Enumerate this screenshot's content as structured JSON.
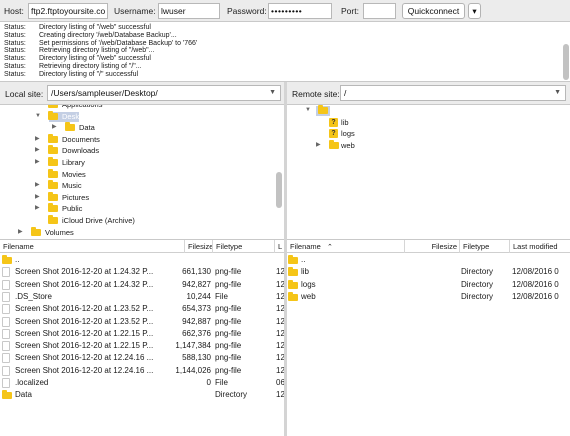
{
  "quickconnect": {
    "host_label": "Host:",
    "host_value": "ftp2.ftptoyoursite.co",
    "username_label": "Username:",
    "username_value": "lwuser",
    "password_label": "Password:",
    "password_value": "•••••••••",
    "port_label": "Port:",
    "port_value": "",
    "connect_label": "Quickconnect",
    "dropdown_glyph": "▾"
  },
  "log": [
    {
      "key": "Status:",
      "msg": "Directory listing of \"/web\" successful"
    },
    {
      "key": "Status:",
      "msg": "Creating directory '/web/Database Backup'..."
    },
    {
      "key": "Status:",
      "msg": "Set permissions of '/web/Database Backup' to '766'"
    },
    {
      "key": "Status:",
      "msg": "Retrieving directory listing of \"/web\"..."
    },
    {
      "key": "Status:",
      "msg": "Directory listing of \"/web\" successful"
    },
    {
      "key": "Status:",
      "msg": "Retrieving directory listing of \"/\"..."
    },
    {
      "key": "Status:",
      "msg": "Directory listing of \"/\" successful"
    }
  ],
  "local_site": {
    "label": "Local site:",
    "path": "/Users/sampleuser/Desktop/"
  },
  "remote_site": {
    "label": "Remote site:",
    "path": "/"
  },
  "local_tree": [
    {
      "name": "Applications",
      "indent": 1,
      "twisty": ""
    },
    {
      "name": "Desktop",
      "indent": 1,
      "twisty": "▼",
      "selected": true
    },
    {
      "name": "Data",
      "indent": 2,
      "twisty": "▶"
    },
    {
      "name": "Documents",
      "indent": 1,
      "twisty": "▶"
    },
    {
      "name": "Downloads",
      "indent": 1,
      "twisty": "▶"
    },
    {
      "name": "Library",
      "indent": 1,
      "twisty": "▶"
    },
    {
      "name": "Movies",
      "indent": 1,
      "twisty": ""
    },
    {
      "name": "Music",
      "indent": 1,
      "twisty": "▶"
    },
    {
      "name": "Pictures",
      "indent": 1,
      "twisty": "▶"
    },
    {
      "name": "Public",
      "indent": 1,
      "twisty": "▶"
    },
    {
      "name": "iCloud Drive (Archive)",
      "indent": 1,
      "twisty": ""
    },
    {
      "name": "Volumes",
      "indent": 0,
      "twisty": "▶"
    }
  ],
  "remote_tree": [
    {
      "name": "",
      "indent": 0,
      "twisty": "▼",
      "icon": "folder",
      "selected": true
    },
    {
      "name": "lib",
      "indent": 1,
      "twisty": "",
      "icon": "unknown"
    },
    {
      "name": "logs",
      "indent": 1,
      "twisty": "",
      "icon": "unknown"
    },
    {
      "name": "web",
      "indent": 1,
      "twisty": "▶",
      "icon": "folder"
    }
  ],
  "local_columns": [
    "Filename",
    "Filesize",
    "Filetype",
    "L"
  ],
  "remote_columns": [
    "Filename",
    "Filesize",
    "Filetype",
    "Last modified"
  ],
  "remote_sort_glyph": "⌃",
  "local_files": [
    {
      "name": "..",
      "size": "",
      "type": "",
      "mod": "",
      "kind": "folder"
    },
    {
      "name": "Screen Shot 2016-12-20 at 1.24.32 P...",
      "size": "661,130",
      "type": "png-file",
      "mod": "12",
      "kind": "file"
    },
    {
      "name": "Screen Shot 2016-12-20 at 1.24.32 P...",
      "size": "942,827",
      "type": "png-file",
      "mod": "12",
      "kind": "file"
    },
    {
      "name": ".DS_Store",
      "size": "10,244",
      "type": "File",
      "mod": "12",
      "kind": "file"
    },
    {
      "name": "Screen Shot 2016-12-20 at 1.23.52 P...",
      "size": "654,373",
      "type": "png-file",
      "mod": "12",
      "kind": "file"
    },
    {
      "name": "Screen Shot 2016-12-20 at 1.23.52 P...",
      "size": "942,887",
      "type": "png-file",
      "mod": "12",
      "kind": "file"
    },
    {
      "name": "Screen Shot 2016-12-20 at 1.22.15 P...",
      "size": "662,376",
      "type": "png-file",
      "mod": "12",
      "kind": "file"
    },
    {
      "name": "Screen Shot 2016-12-20 at 1.22.15 P...",
      "size": "1,147,384",
      "type": "png-file",
      "mod": "12",
      "kind": "file"
    },
    {
      "name": "Screen Shot 2016-12-20 at 12.24.16 ...",
      "size": "588,130",
      "type": "png-file",
      "mod": "12",
      "kind": "file"
    },
    {
      "name": "Screen Shot 2016-12-20 at 12.24.16 ...",
      "size": "1,144,026",
      "type": "png-file",
      "mod": "12",
      "kind": "file"
    },
    {
      "name": ".localized",
      "size": "0",
      "type": "File",
      "mod": "06",
      "kind": "file"
    },
    {
      "name": "Data",
      "size": "",
      "type": "Directory",
      "mod": "12",
      "kind": "folder"
    }
  ],
  "remote_files": [
    {
      "name": "..",
      "size": "",
      "type": "",
      "mod": "",
      "kind": "folder"
    },
    {
      "name": "lib",
      "size": "",
      "type": "Directory",
      "mod": "12/08/2016 0",
      "kind": "folder"
    },
    {
      "name": "logs",
      "size": "",
      "type": "Directory",
      "mod": "12/08/2016 0",
      "kind": "folder"
    },
    {
      "name": "web",
      "size": "",
      "type": "Directory",
      "mod": "12/08/2016 0",
      "kind": "folder"
    }
  ],
  "colors": {
    "folder": "#f5c518",
    "selection": "#c4cfe4",
    "chrome": "#ececec"
  }
}
